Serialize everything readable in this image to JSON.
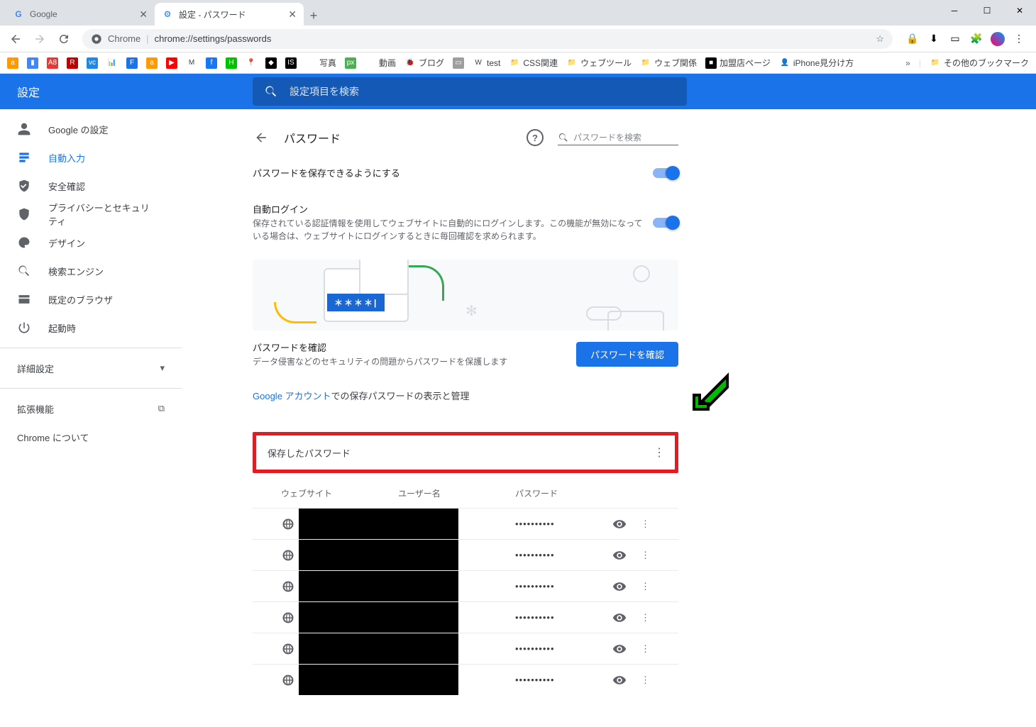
{
  "window": {
    "minimize": "—",
    "maximize": "☐",
    "close": "✕"
  },
  "tabs": [
    {
      "title": "Google",
      "favicon": "G",
      "active": false
    },
    {
      "title": "設定 - パスワード",
      "favicon": "⚙",
      "active": true
    }
  ],
  "toolbar": {
    "chrome_label": "Chrome",
    "url": "chrome://settings/passwords"
  },
  "bookmarks": [
    {
      "icon": "a",
      "bg": "#ff9900",
      "label": ""
    },
    {
      "icon": "▮",
      "bg": "#4285f4",
      "label": ""
    },
    {
      "icon": "A8",
      "bg": "#e53935",
      "label": ""
    },
    {
      "icon": "R",
      "bg": "#bf0000",
      "label": ""
    },
    {
      "icon": "vc",
      "bg": "#1e88e5",
      "label": ""
    },
    {
      "icon": "📊",
      "bg": "",
      "label": ""
    },
    {
      "icon": "F",
      "bg": "#1a73e8",
      "label": ""
    },
    {
      "icon": "a",
      "bg": "#ff9900",
      "label": ""
    },
    {
      "icon": "▶",
      "bg": "#ff0000",
      "label": ""
    },
    {
      "icon": "M",
      "bg": "",
      "label": ""
    },
    {
      "icon": "f",
      "bg": "#1877f2",
      "label": ""
    },
    {
      "icon": "H",
      "bg": "#00c300",
      "label": ""
    },
    {
      "icon": "📍",
      "bg": "",
      "label": ""
    },
    {
      "icon": "◆",
      "bg": "#000",
      "label": ""
    },
    {
      "icon": "IS",
      "bg": "#000",
      "label": ""
    },
    {
      "icon": "",
      "bg": "",
      "label": "写真"
    },
    {
      "icon": "px",
      "bg": "#4caf50",
      "label": ""
    },
    {
      "icon": "",
      "bg": "",
      "label": "動画"
    },
    {
      "icon": "🐞",
      "bg": "",
      "label": "ブログ"
    },
    {
      "icon": "▭",
      "bg": "#9e9e9e",
      "label": ""
    },
    {
      "icon": "W",
      "bg": "",
      "label": "test"
    },
    {
      "icon": "📁",
      "bg": "",
      "label": "CSS関連"
    },
    {
      "icon": "📁",
      "bg": "",
      "label": "ウェブツール"
    },
    {
      "icon": "📁",
      "bg": "",
      "label": "ウェブ関係"
    },
    {
      "icon": "■",
      "bg": "#000",
      "label": "加盟店ページ"
    },
    {
      "icon": "👤",
      "bg": "",
      "label": "iPhone見分け方"
    }
  ],
  "bookmarks_more": "»",
  "bookmarks_other": "その他のブックマーク",
  "header": {
    "title": "設定",
    "search_placeholder": "設定項目を検索"
  },
  "sidebar": {
    "items": [
      {
        "icon": "person",
        "label": "Google の設定"
      },
      {
        "icon": "autofill",
        "label": "自動入力"
      },
      {
        "icon": "shield",
        "label": "安全確認"
      },
      {
        "icon": "privacy",
        "label": "プライバシーとセキュリティ"
      },
      {
        "icon": "palette",
        "label": "デザイン"
      },
      {
        "icon": "search",
        "label": "検索エンジン"
      },
      {
        "icon": "browser",
        "label": "既定のブラウザ"
      },
      {
        "icon": "power",
        "label": "起動時"
      }
    ],
    "advanced": "詳細設定",
    "extensions": "拡張機能",
    "about": "Chrome について"
  },
  "page": {
    "heading": "パスワード",
    "search_placeholder": "パスワードを検索",
    "offer_save": "パスワードを保存できるようにする",
    "auto_signin_title": "自動ログイン",
    "auto_signin_desc": "保存されている認証情報を使用してウェブサイトに自動的にログインします。この機能が無効になっている場合は、ウェブサイトにログインするときに毎回確認を求められます。",
    "illust_pw": "＊＊＊＊|",
    "check_title": "パスワードを確認",
    "check_desc": "データ侵害などのセキュリティの問題からパスワードを保護します",
    "check_btn": "パスワードを確認",
    "account_link_pre": "Google アカウント",
    "account_link_post": "での保存パスワードの表示と管理",
    "saved_title": "保存したパスワード",
    "table": {
      "website": "ウェブサイト",
      "username": "ユーザー名",
      "password": "パスワード"
    },
    "rows": [
      {
        "pw": "••••••••••"
      },
      {
        "pw": "••••••••••"
      },
      {
        "pw": "••••••••••"
      },
      {
        "pw": "••••••••••"
      },
      {
        "pw": "••••••••••"
      },
      {
        "pw": "••••••••••"
      }
    ]
  }
}
